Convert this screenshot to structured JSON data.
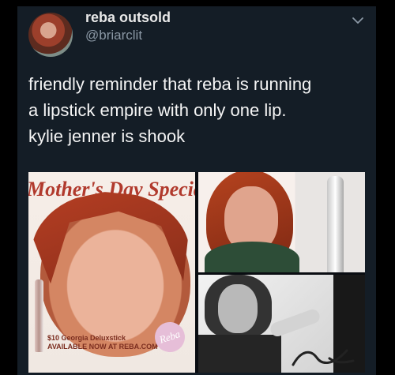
{
  "tweet": {
    "display_name": "reba outsold",
    "handle": "@briarclit",
    "text_lines": [
      "friendly reminder that reba is running",
      "a lipstick empire with only one lip.",
      "kylie jenner is shook"
    ],
    "chevron_icon": "chevron-down-icon"
  },
  "media": {
    "banner_text": "Mother's Day Special!",
    "caption_line1": "$10 Georgia Deluxstick",
    "caption_line2": "AVAILABLE NOW AT REBA.COM",
    "logo_text": "Reba"
  },
  "colors": {
    "background": "#000000",
    "card": "#141d26",
    "text_primary": "#f5f5f5",
    "text_secondary": "#8b98a5"
  }
}
